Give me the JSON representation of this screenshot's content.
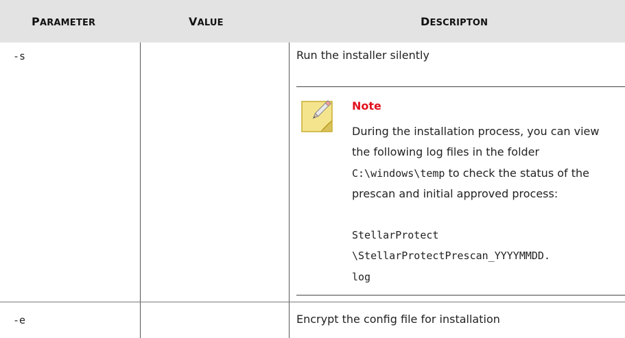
{
  "table": {
    "headers": [
      "Parameter",
      "Value",
      "Descripton"
    ],
    "rows": [
      {
        "parameter": "-s",
        "value": "",
        "description": "Run the installer silently",
        "note": {
          "title": "Note",
          "text_before": "During the installation process, you can view the following log files in the folder",
          "path_inline": "C:\\windows\\temp",
          "text_after": "to check the status of the prescan and initial approved process:",
          "log_line1": "StellarProtect",
          "log_line2": "\\StellarProtectPrescan_YYYYMMDD.",
          "log_line3": "log"
        }
      },
      {
        "parameter": "-e",
        "value": "",
        "description": "Encrypt the config file for installation"
      }
    ]
  },
  "icons": {
    "note": "note-pencil-icon"
  },
  "colors": {
    "header_bg": "#e3e3e3",
    "note_title": "#e1121f",
    "note_icon": "#f2e28a"
  }
}
